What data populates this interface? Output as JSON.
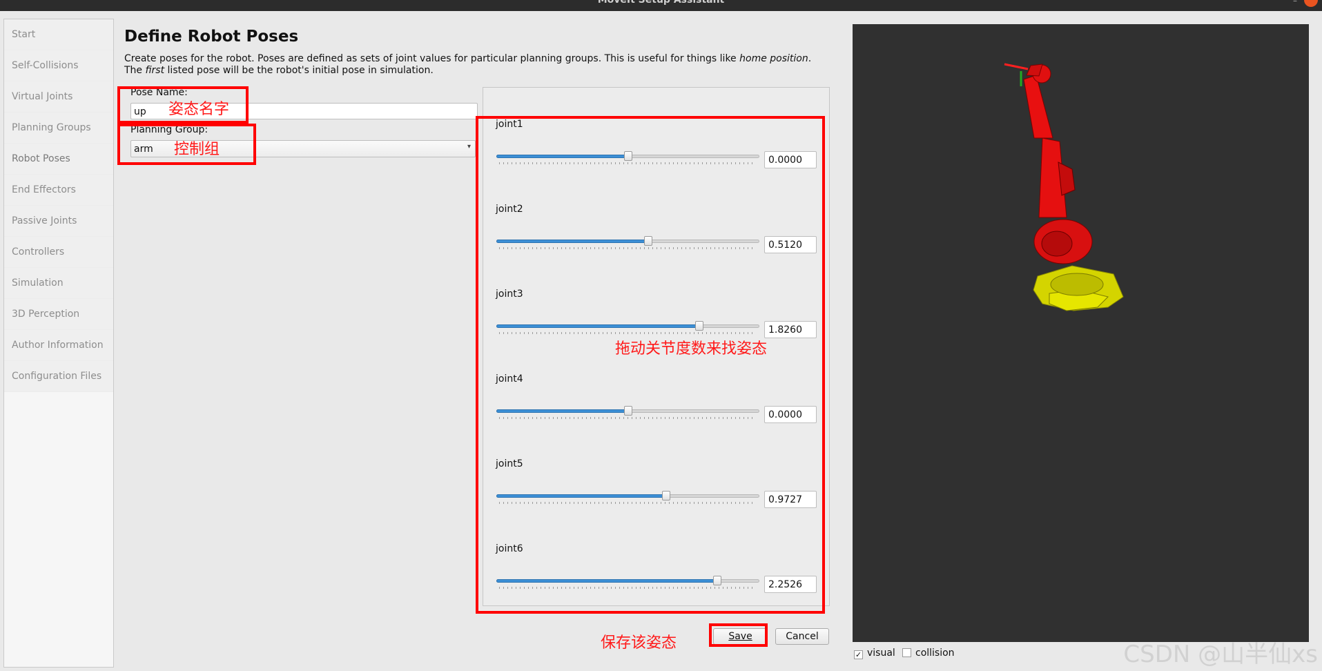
{
  "window": {
    "title": "MoveIt Setup Assistant"
  },
  "sidebar": {
    "items": [
      {
        "label": "Start"
      },
      {
        "label": "Self-Collisions"
      },
      {
        "label": "Virtual Joints"
      },
      {
        "label": "Planning Groups"
      },
      {
        "label": "Robot Poses"
      },
      {
        "label": "End Effectors"
      },
      {
        "label": "Passive Joints"
      },
      {
        "label": "Controllers"
      },
      {
        "label": "Simulation"
      },
      {
        "label": "3D Perception"
      },
      {
        "label": "Author Information"
      },
      {
        "label": "Configuration Files"
      }
    ]
  },
  "page": {
    "title": "Define Robot Poses",
    "desc_part1": "Create poses for the robot. Poses are defined as sets of joint values for particular planning groups. This is useful for things like ",
    "desc_em1": "home position",
    "desc_part2": ". The ",
    "desc_em2": "first",
    "desc_part3": " listed pose will be the robot's initial pose in simulation."
  },
  "form": {
    "pose_name_label": "Pose Name:",
    "pose_name_value": "up",
    "planning_group_label": "Planning Group:",
    "planning_group_value": "arm"
  },
  "joints": [
    {
      "name": "joint1",
      "value": "0.0000",
      "fraction": 0.5
    },
    {
      "name": "joint2",
      "value": "0.5120",
      "fraction": 0.58
    },
    {
      "name": "joint3",
      "value": "1.8260",
      "fraction": 0.78
    },
    {
      "name": "joint4",
      "value": "0.0000",
      "fraction": 0.5
    },
    {
      "name": "joint5",
      "value": "0.9727",
      "fraction": 0.65
    },
    {
      "name": "joint6",
      "value": "2.2526",
      "fraction": 0.85
    }
  ],
  "buttons": {
    "save": "Save",
    "cancel": "Cancel"
  },
  "viewer": {
    "visual_label": "visual",
    "visual_checked": true,
    "collision_label": "collision",
    "collision_checked": false
  },
  "annotations": {
    "pose_name": "姿态名字",
    "planning_group": "控制组",
    "joints": "拖动关节度数来找姿态",
    "save": "保存该姿态"
  },
  "watermark": "CSDN @山半仙xs",
  "colors": {
    "annotation": "#ff0000",
    "robot": "#e81010",
    "robot_base": "#e6e600",
    "viewport_bg": "#303030",
    "slider_fill": "#3c8fd6"
  }
}
